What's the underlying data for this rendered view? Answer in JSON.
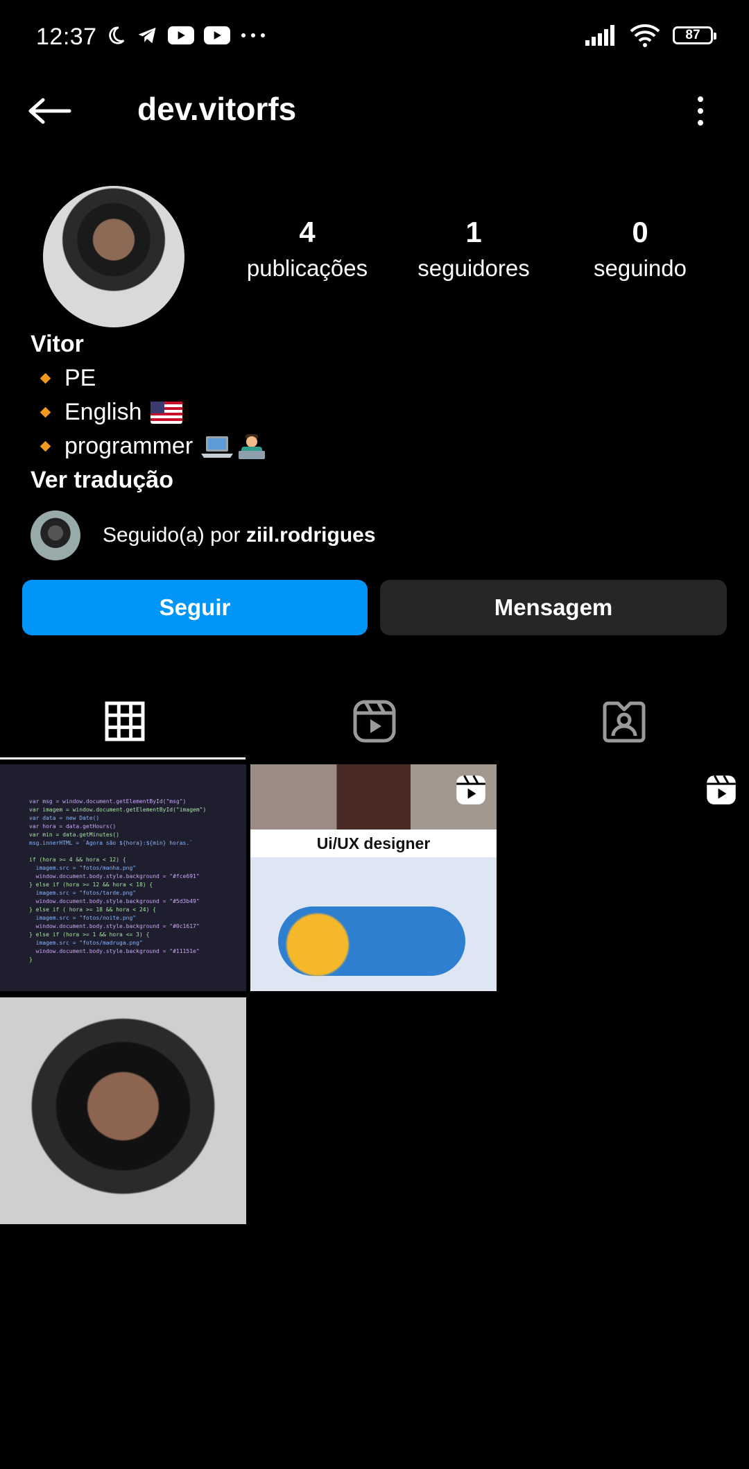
{
  "status_bar": {
    "time": "12:37",
    "battery": "87"
  },
  "header": {
    "username": "dev.vitorfs"
  },
  "stats": [
    {
      "value": "4",
      "label": "publicações"
    },
    {
      "value": "1",
      "label": "seguidores"
    },
    {
      "value": "0",
      "label": "seguindo"
    }
  ],
  "bio": {
    "name": "Vitor",
    "lines": [
      "PE",
      "English",
      "programmer"
    ],
    "translate": "Ver tradução"
  },
  "followed_by": {
    "prefix": "Seguido(a) por",
    "user": "ziil.rodrigues"
  },
  "buttons": {
    "follow": "Seguir",
    "message": "Mensagem"
  },
  "tabs": [
    "grid-icon",
    "reels-icon",
    "tagged-icon"
  ],
  "posts": {
    "ux_caption": "Ui/UX designer"
  },
  "colors": {
    "accent": "#0095f6",
    "secondary_button": "#262626",
    "bullet": "#f29a1f"
  }
}
